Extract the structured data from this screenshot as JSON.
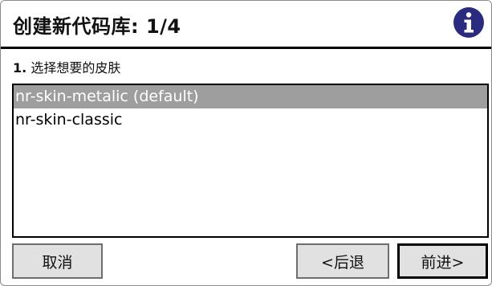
{
  "dialog": {
    "title": "创建新代码库: 1/4",
    "info_icon": "info-circle-icon",
    "accent_color": "#2a2a7f"
  },
  "step": {
    "number": "1.",
    "text": "选择想要的皮肤"
  },
  "skins": {
    "items": [
      {
        "label": "nr-skin-metalic (default)",
        "selected": true
      },
      {
        "label": "nr-skin-classic",
        "selected": false
      }
    ],
    "selected_bg": "#9e9e9e"
  },
  "buttons": {
    "cancel": "取消",
    "back": "<后退",
    "next": "前进>"
  }
}
